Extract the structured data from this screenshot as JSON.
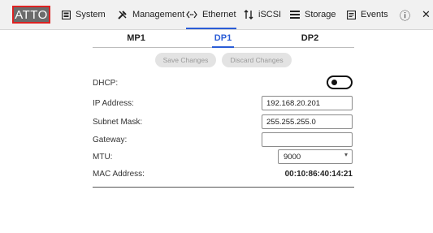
{
  "brand": {
    "logo_text": "ATTO",
    "accent": "#2a5cd6",
    "logo_border": "#dd2222"
  },
  "nav": {
    "items": [
      {
        "label": "System",
        "icon": "system-icon"
      },
      {
        "label": "Management",
        "icon": "tools-icon"
      },
      {
        "label": "Ethernet",
        "icon": "ethernet-icon",
        "active": true
      },
      {
        "label": "iSCSI",
        "icon": "iscsi-icon"
      },
      {
        "label": "Storage",
        "icon": "storage-icon"
      },
      {
        "label": "Events",
        "icon": "events-icon"
      }
    ],
    "info_icon": "info-icon",
    "close_icon": "close-icon",
    "info_glyph": "ⓘ",
    "close_glyph": "✕"
  },
  "tabs": [
    {
      "label": "MP1"
    },
    {
      "label": "DP1",
      "active": true
    },
    {
      "label": "DP2"
    }
  ],
  "actions": {
    "save_label": "Save Changes",
    "discard_label": "Discard Changes"
  },
  "form": {
    "dhcp_label": "DHCP:",
    "dhcp_enabled": false,
    "ip_label": "IP Address:",
    "ip_value": "192.168.20.201",
    "subnet_label": "Subnet Mask:",
    "subnet_value": "255.255.255.0",
    "gateway_label": "Gateway:",
    "gateway_value": "",
    "mtu_label": "MTU:",
    "mtu_value": "9000",
    "mac_label": "MAC Address:",
    "mac_value": "00:10:86:40:14:21"
  }
}
